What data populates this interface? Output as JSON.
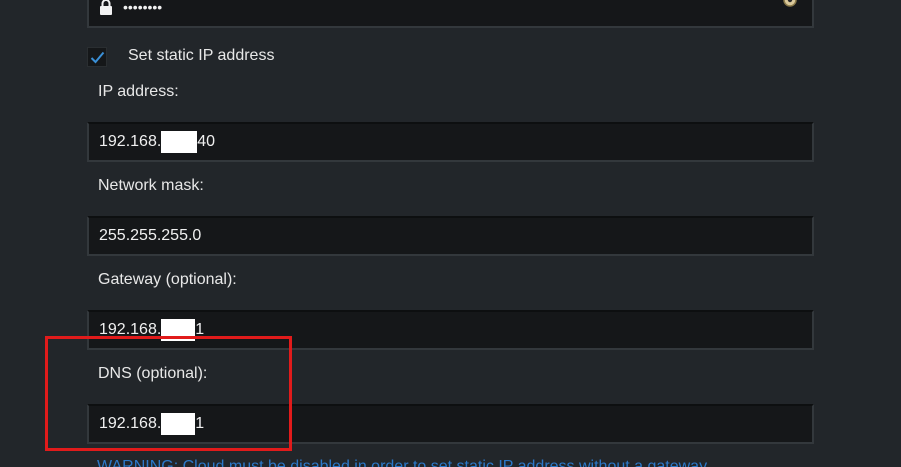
{
  "password": {
    "masked_value": "••••••••"
  },
  "static_ip": {
    "checked": true,
    "label": "Set static IP address"
  },
  "ip_address": {
    "label": "IP address:",
    "value_prefix": "192.168.",
    "value_suffix": "40"
  },
  "network_mask": {
    "label": "Network mask:",
    "value": "255.255.255.0"
  },
  "gateway": {
    "label": "Gateway (optional):",
    "value_prefix": "192.168.",
    "value_suffix": "1"
  },
  "dns": {
    "label": "DNS (optional):",
    "value_prefix": "192.168.",
    "value_suffix": "1"
  },
  "warning": {
    "text": "WARNING: Cloud must be disabled in order to set static IP address without a gateway"
  },
  "colors": {
    "highlight": "#e11b1b",
    "warning_link": "#2b78c9",
    "check": "#3a8fd6"
  },
  "icons": {
    "lock": "lock-icon",
    "key": "key-icon",
    "check": "checkmark-icon"
  }
}
